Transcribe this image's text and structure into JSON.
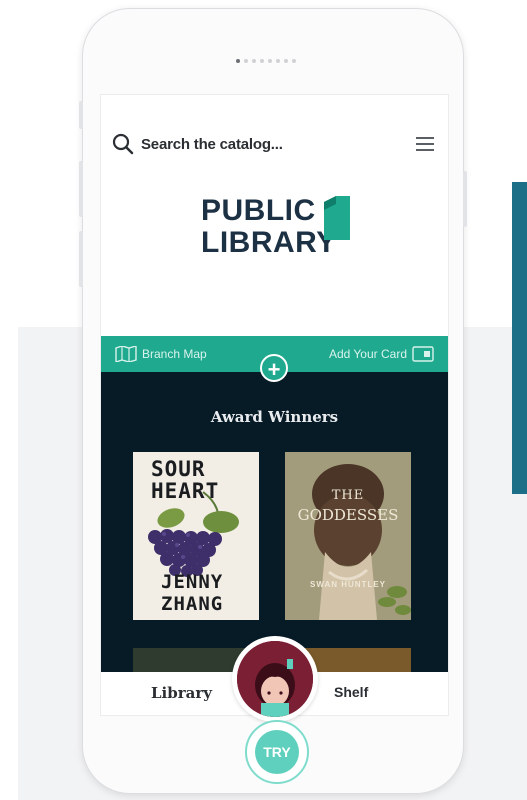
{
  "screen": {
    "search": {
      "placeholder": "Search the catalog...",
      "icon": "search-icon"
    },
    "menu": {
      "icon": "hamburger-menu-icon"
    },
    "logo": {
      "line1": "PUBLIC",
      "line2": "LIBRARY",
      "accent": "#1fa98f",
      "text_color": "#1d3144"
    },
    "action_bar": {
      "left": {
        "label": "Branch Map",
        "icon": "map-icon"
      },
      "right": {
        "label": "Add Your Card",
        "icon": "card-icon"
      },
      "plus_icon": "plus-icon",
      "plus_label": "+"
    },
    "section": {
      "title": "Award Winners",
      "books": [
        {
          "title_lines": [
            "SOUR",
            "HEART"
          ],
          "author_lines": [
            "JENNY",
            "ZHANG"
          ]
        },
        {
          "title_lines": [
            "THE",
            "GODDESSES"
          ],
          "author_lines": [
            "SWAN HUNTLEY"
          ]
        }
      ]
    },
    "tabs": {
      "library": "Library",
      "shelf": "Shelf"
    }
  },
  "try_button": {
    "label": "TRY"
  },
  "colors": {
    "teal": "#1fa98f",
    "dark_navy": "#071b27",
    "side_panel": "#1c6f86",
    "avatar_bg": "#7b1f34",
    "try": "#5fd0bd"
  }
}
